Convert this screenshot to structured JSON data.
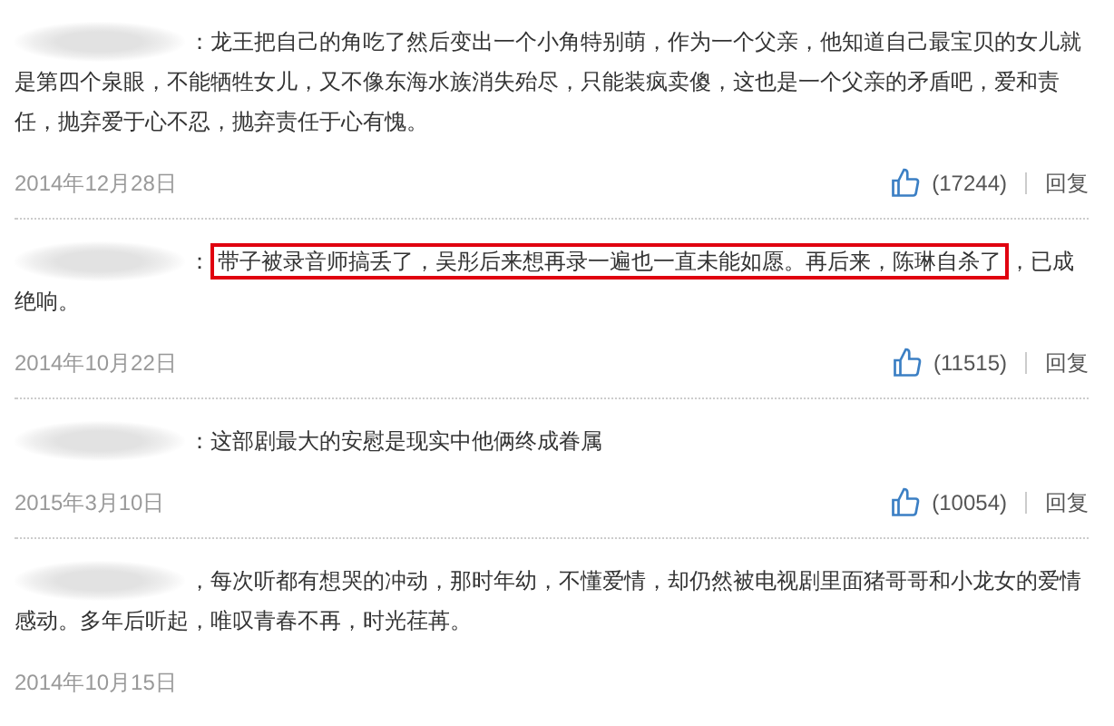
{
  "comments": [
    {
      "segments": [
        {
          "text": "：龙王把自己的角吃了然后变出一个小角特别萌，作为一个父亲，他知道自己最宝贝的女儿就是第四个泉眼，不能牺牲女儿，又不像东海水族消失殆尽，只能装疯卖傻，这也是一个父亲的矛盾吧，爱和责任，抛弃爱于心不忍，抛弃责任于心有愧。",
          "highlighted": false
        }
      ],
      "date": "2014年12月28日",
      "likes": "(17244)",
      "reply": "回复"
    },
    {
      "segments": [
        {
          "text": "：",
          "highlighted": false
        },
        {
          "text": "带子被录音师搞丢了，吴彤后来想再录一遍也一直未能如愿。再后来，陈琳自杀了",
          "highlighted": true
        },
        {
          "text": "，已成绝响。",
          "highlighted": false
        }
      ],
      "date": "2014年10月22日",
      "likes": "(11515)",
      "reply": "回复"
    },
    {
      "segments": [
        {
          "text": "：这部剧最大的安慰是现实中他俩终成眷属",
          "highlighted": false
        }
      ],
      "date": "2015年3月10日",
      "likes": "(10054)",
      "reply": "回复"
    },
    {
      "segments": [
        {
          "text": "，每次听都有想哭的冲动，那时年幼，不懂爱情，却仍然被电视剧里面猪哥哥和小龙女的爱情感动。多年后听起，唯叹青春不再，时光荏苒。",
          "highlighted": false
        }
      ],
      "date": "2014年10月15日"
    }
  ]
}
